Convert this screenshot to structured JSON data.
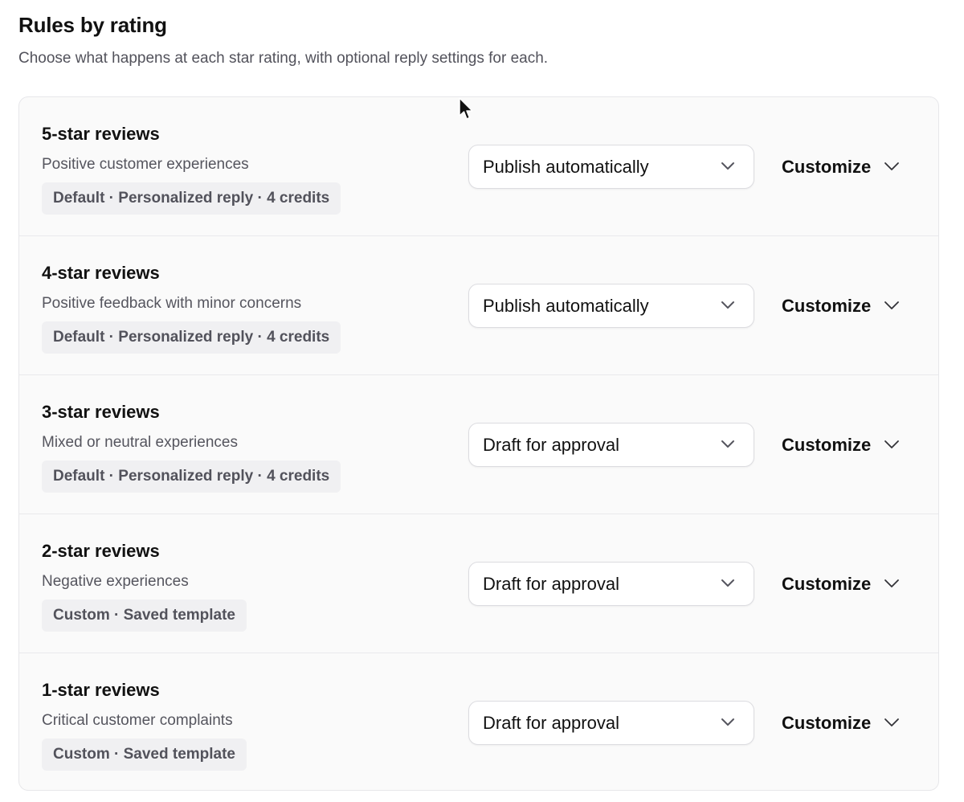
{
  "header": {
    "title": "Rules by rating",
    "subtitle": "Choose what happens at each star rating, with optional reply settings for each."
  },
  "rules": [
    {
      "title": "5-star reviews",
      "description": "Positive customer experiences",
      "badge": "Default · Personalized reply · 4 credits",
      "action": "Publish automatically",
      "customize_label": "Customize"
    },
    {
      "title": "4-star reviews",
      "description": "Positive feedback with minor concerns",
      "badge": "Default · Personalized reply · 4 credits",
      "action": "Publish automatically",
      "customize_label": "Customize"
    },
    {
      "title": "3-star reviews",
      "description": "Mixed or neutral experiences",
      "badge": "Default · Personalized reply · 4 credits",
      "action": "Draft for approval",
      "customize_label": "Customize"
    },
    {
      "title": "2-star reviews",
      "description": "Negative experiences",
      "badge": "Custom · Saved template",
      "action": "Draft for approval",
      "customize_label": "Customize"
    },
    {
      "title": "1-star reviews",
      "description": "Critical customer complaints",
      "badge": "Custom · Saved template",
      "action": "Draft for approval",
      "customize_label": "Customize"
    }
  ],
  "icons": {
    "select_chevron": "chevron-down-icon",
    "customize_chevron": "chevron-down-icon",
    "cursor": "mouse-cursor-icon"
  },
  "colors": {
    "text_primary": "#111111",
    "text_secondary": "#55555e",
    "card_background": "#fafafa",
    "badge_background": "#f0f0f2",
    "border": "#e7e7ea"
  }
}
